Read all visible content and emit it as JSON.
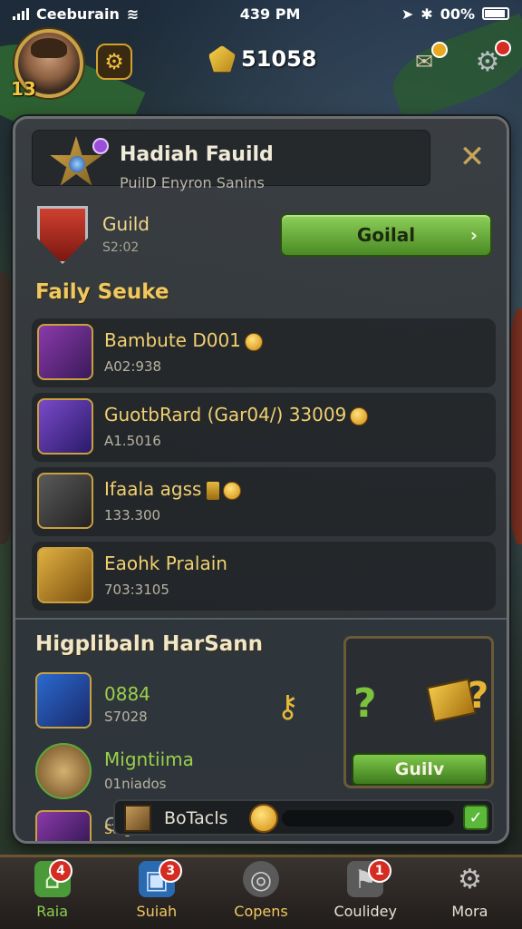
{
  "status_bar": {
    "carrier": "Ceeburain",
    "time": "439 PM",
    "battery": "00%"
  },
  "hud": {
    "player_level": "13",
    "currency_value": "51058",
    "icons": [
      "settings-gear-icon",
      "gold-gem-icon",
      "mail-icon",
      "gear-icon"
    ]
  },
  "panel": {
    "guild_title": "Hadiah Fauild",
    "guild_subtitle": "PuilD Enyron Sanins",
    "guild_label": "Guild",
    "guild_id": "S2:02",
    "guild_button": "Goilal",
    "section_title": "Faily Seuke",
    "items": [
      {
        "name": "Bambute D001",
        "sub": "A02:938",
        "icon_color": "#6a2a8a"
      },
      {
        "name": "GuotbRard (Gar04/) 33009",
        "sub": "A1.5016",
        "icon_color": "#4a2a8a"
      },
      {
        "name": "Ifaala agss",
        "sub": "133.300",
        "icon_color": "#3a3a3a"
      },
      {
        "name": "Eaohk Pralain",
        "sub": "703:3105",
        "icon_color": "#7a5a18"
      }
    ],
    "lower_section_title": "Higplibaln HarSann",
    "lower_items": [
      {
        "name": "0884",
        "sub": "S7028"
      },
      {
        "name": "Migntiima",
        "sub": "01niados"
      }
    ],
    "partial_item": {
      "name": "G",
      "sub": "Sulgia"
    },
    "reward_button": "Guilv",
    "progress_label": "BoTacls",
    "progress_fraction": 0
  },
  "bottom_nav": [
    {
      "label": "Raia",
      "badge": "4",
      "color": "#4a9a3a"
    },
    {
      "label": "Suiah",
      "badge": "3",
      "color": "#2a6ab0"
    },
    {
      "label": "Copens",
      "badge": "",
      "color": "#6a6a6a"
    },
    {
      "label": "Coulidey",
      "badge": "1",
      "color": "#5a5a5a"
    },
    {
      "label": "Mora",
      "badge": "",
      "color": "#5a5a5a"
    }
  ]
}
